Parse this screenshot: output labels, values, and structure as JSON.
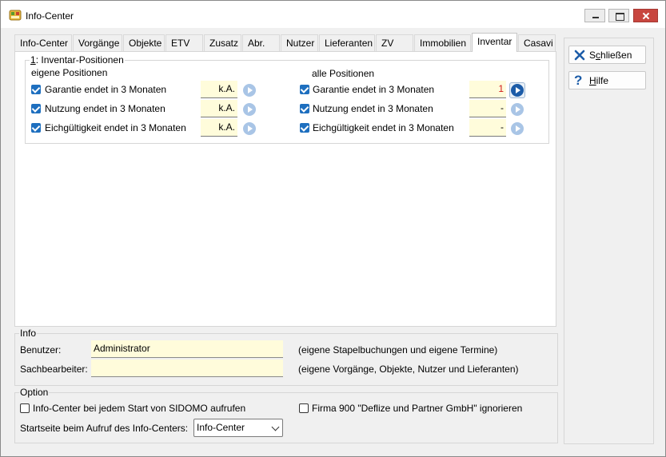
{
  "window": {
    "title": "Info-Center"
  },
  "tabs": [
    "Info-Center",
    "Vorgänge",
    "Objekte",
    "ETV",
    "Zusatz",
    "Abr.",
    "Nutzer",
    "Lieferanten",
    "ZV",
    "Immobilien",
    "Inventar",
    "Casavi"
  ],
  "active_tab": "Inventar",
  "inventar": {
    "group_title_key": "1",
    "group_title_rest": ": Inventar-Positionen",
    "eigene_header": "eigene Positionen",
    "alle_header": "alle Positionen",
    "eigene_rows": [
      {
        "label": "Garantie endet in 3 Monaten",
        "value": "k.A.",
        "checked": true
      },
      {
        "label": "Nutzung endet in 3 Monaten",
        "value": "k.A.",
        "checked": true
      },
      {
        "label": "Eichgültigkeit endet in 3 Monaten",
        "value": "k.A.",
        "checked": true
      }
    ],
    "alle_rows": [
      {
        "label": "Garantie endet in 3 Monaten",
        "value": "1",
        "checked": true
      },
      {
        "label": "Nutzung endet in 3 Monaten",
        "value": "-",
        "checked": true
      },
      {
        "label": "Eichgültigkeit endet in 3 Monaten",
        "value": "-",
        "checked": true
      }
    ]
  },
  "info": {
    "legend": "Info",
    "benutzer_label": "Benutzer:",
    "benutzer_value": "Administrator",
    "benutzer_note": "(eigene Stapelbuchungen und eigene Termine)",
    "sachbearbeiter_label": "Sachbearbeiter:",
    "sachbearbeiter_value": "",
    "sachbearbeiter_note": "(eigene Vorgänge, Objekte, Nutzer und Lieferanten)"
  },
  "option": {
    "legend": "Option",
    "startup_label": "Info-Center bei jedem Start von SIDOMO aufrufen",
    "startup_checked": false,
    "firma_label": "Firma 900 \"Deflize und Partner GmbH\" ignorieren",
    "firma_checked": false,
    "startseite_label": "Startseite beim Aufruf des Info-Centers:",
    "startseite_value": "Info-Center"
  },
  "side": {
    "close_hotkey": "c",
    "close_pre": "S",
    "close_post": "hließen",
    "help_hotkey": "H",
    "help_post": "ilfe"
  },
  "colors": {
    "accent": "#1e6fbf",
    "field_bg": "#fffcdb",
    "alert_value": "#d11a1a"
  },
  "icons": {
    "close": "x-icon",
    "help": "question-icon",
    "go": "play-circle-icon"
  }
}
